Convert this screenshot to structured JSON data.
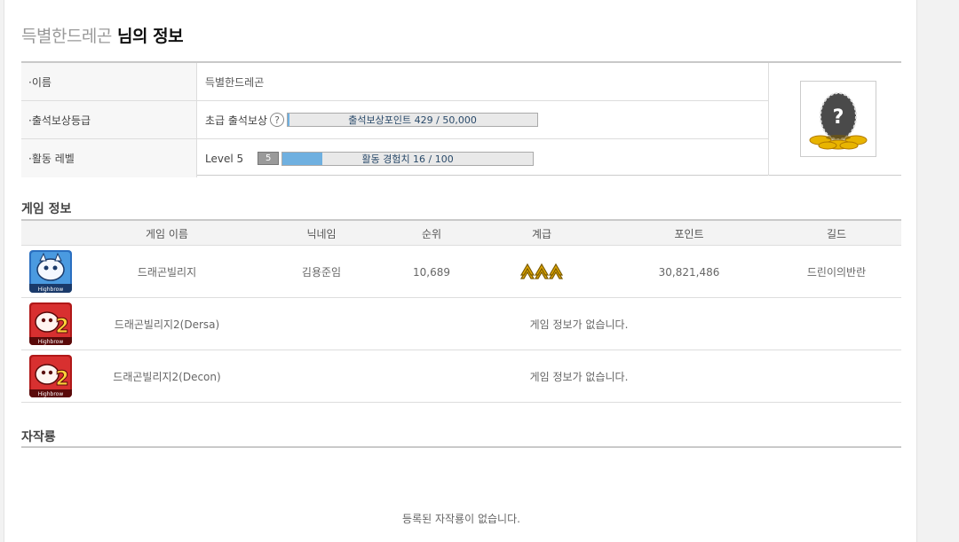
{
  "profile": {
    "username": "득별한드레곤",
    "title_suffix": "님의 정보"
  },
  "info": {
    "name_label": "·이름",
    "name_value": "득별한드레곤",
    "attendance_label": "·출석보상등급",
    "attendance_grade": "초급 출석보상",
    "attendance_help": "?",
    "attendance_bar_text": "출석보상포인트 429 / 50,000",
    "attendance_progress": 0.0086,
    "activity_label": "·활동 레벨",
    "activity_level_text": "Level 5",
    "activity_badge": "5",
    "activity_bar_text": "활동 경험치 16 / 100",
    "activity_progress": 0.16,
    "avatar_icon": "question-egg-icon"
  },
  "game_section": {
    "title": "게임 정보",
    "columns": [
      "게임 이름",
      "닉네임",
      "순위",
      "계급",
      "포인트",
      "길드"
    ],
    "rows": [
      {
        "icon": "dragon-village-icon",
        "name": "드래곤빌리지",
        "nickname": "김용준임",
        "rank": "10,689",
        "grade_icon": "rank-chevrons-icon",
        "points": "30,821,486",
        "guild": "드린이의반란"
      },
      {
        "icon": "dragon-village-2-icon",
        "name": "드래곤빌리지2(Dersa)",
        "empty": "게임 정보가 없습니다."
      },
      {
        "icon": "dragon-village-2-icon",
        "name": "드래곤빌리지2(Decon)",
        "empty": "게임 정보가 없습니다."
      }
    ]
  },
  "fan_section": {
    "title": "자작룡",
    "empty": "등록된 자작룡이 없습니다."
  },
  "colors": {
    "bar_fill": "#6fb0e0",
    "accent_gold": "#e0a800"
  }
}
